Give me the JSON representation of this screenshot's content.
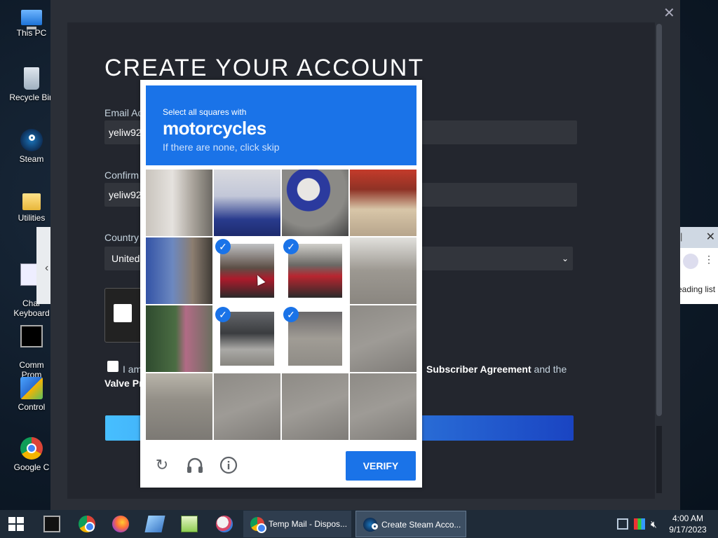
{
  "desktop": {
    "icons": [
      {
        "label": "This PC"
      },
      {
        "label": "Recycle Bin"
      },
      {
        "label": "Steam"
      },
      {
        "label": "Utilities"
      },
      {
        "label": "Char\nKeyboard"
      },
      {
        "label": "Comm\nProm"
      },
      {
        "label": "Control"
      },
      {
        "label": "Google C"
      }
    ]
  },
  "background_window": {
    "right_label": "eading list",
    "close": "✕"
  },
  "steam": {
    "close": "✕",
    "title": "CREATE YOUR ACCOUNT",
    "email_label": "Email Ad",
    "email_value": "yeliw92",
    "confirm_label": "Confirm",
    "confirm_value": "yeliw92",
    "country_label": "Country",
    "country_value": "United",
    "agree_prefix": "I am",
    "agree_suffix_bold": "Subscriber Agreement",
    "agree_suffix_rest": " and the",
    "agree_line2": "Valve Pr"
  },
  "captcha": {
    "instruction": "Select all squares with",
    "target": "motorcycles",
    "hint": "If there are none, click skip",
    "verify_label": "VERIFY",
    "selected_tiles": [
      5,
      6,
      9,
      10
    ]
  },
  "taskbar": {
    "apps": [
      {
        "label": "Temp Mail - Dispos...",
        "active": false
      },
      {
        "label": "Create Steam Acco...",
        "active": true
      }
    ],
    "time": "4:00 AM",
    "date": "9/17/2023"
  },
  "colors": {
    "captcha_blue": "#1a73e8",
    "steam_bg": "#23262e",
    "taskbar": "#1f2b38"
  }
}
